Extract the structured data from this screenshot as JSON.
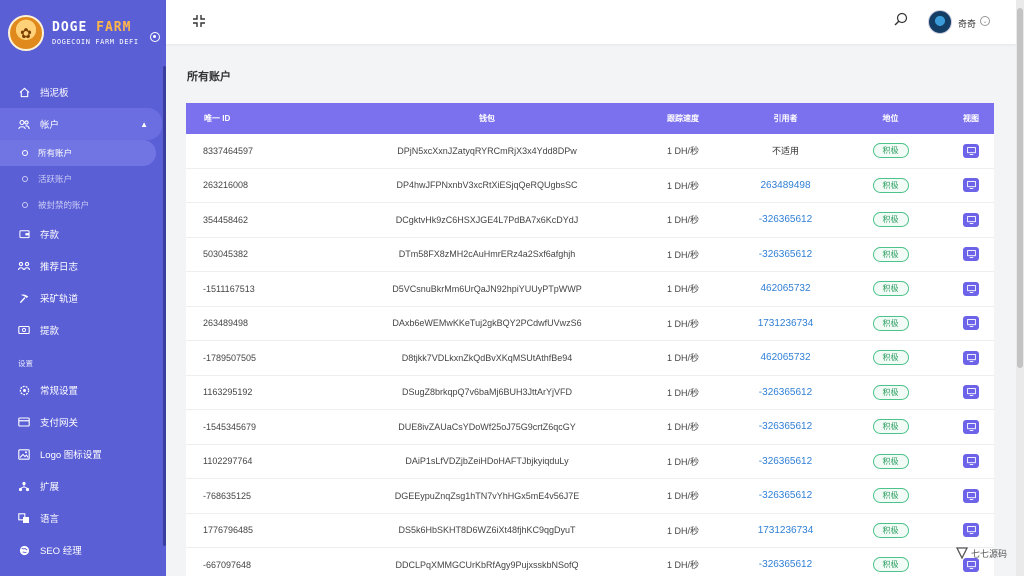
{
  "brand": {
    "title_main": "DOGE",
    "title_accent": "FARM",
    "subtitle": "DOGECOIN FARM DEFI"
  },
  "nav": {
    "dashboard": "挡泥板",
    "accounts": "帐户",
    "sub_all": "所有账户",
    "sub_active": "活跃账户",
    "sub_banned": "被封禁的账户",
    "deposit": "存款",
    "referral_log": "推荐日志",
    "mining_track": "采矿轨道",
    "withdraw": "提款",
    "section_settings": "设置",
    "general_settings": "常规设置",
    "payment_gateway": "支付网关",
    "logo_settings": "Logo 图标设置",
    "extensions": "扩展",
    "language": "语言",
    "seo": "SEO 经理"
  },
  "topbar": {
    "username": "奇奇"
  },
  "page": {
    "title": "所有账户"
  },
  "table": {
    "headers": [
      "唯一 ID",
      "钱包",
      "跟踪速度",
      "引用者",
      "地位",
      "视图"
    ],
    "rows": [
      {
        "id": "8337464597",
        "wallet": "DPjN5xcXxnJZatyqRYRCmRjX3x4Ydd8DPw",
        "speed": "1 DH/秒",
        "ref": "不适用",
        "status": "积极"
      },
      {
        "id": "263216008",
        "wallet": "DP4hwJFPNxnbV3xcRtXiESjqQeRQUgbsSC",
        "speed": "1 DH/秒",
        "ref": "263489498",
        "status": "积极"
      },
      {
        "id": "354458462",
        "wallet": "DCgktvHk9zC6HSXJGE4L7PdBA7x6KcDYdJ",
        "speed": "1 DH/秒",
        "ref": "-326365612",
        "status": "积极"
      },
      {
        "id": "503045382",
        "wallet": "DTm58FX8zMH2cAuHmrERz4a2Sxf6afghjh",
        "speed": "1 DH/秒",
        "ref": "-326365612",
        "status": "积极"
      },
      {
        "id": "-1511167513",
        "wallet": "D5VCsnuBkrMm6UrQaJN92hpiYUUyPTpWWP",
        "speed": "1 DH/秒",
        "ref": "462065732",
        "status": "积极"
      },
      {
        "id": "263489498",
        "wallet": "DAxb6eWEMwKKeTuj2gkBQY2PCdwfUVwzS6",
        "speed": "1 DH/秒",
        "ref": "1731236734",
        "status": "积极"
      },
      {
        "id": "-1789507505",
        "wallet": "D8tjkk7VDLkxnZkQdBvXKqMSUtAthfBe94",
        "speed": "1 DH/秒",
        "ref": "462065732",
        "status": "积极"
      },
      {
        "id": "1163295192",
        "wallet": "DSugZ8brkqpQ7v6baMj6BUH3JttArYjVFD",
        "speed": "1 DH/秒",
        "ref": "-326365612",
        "status": "积极"
      },
      {
        "id": "-1545345679",
        "wallet": "DUE8ivZAUaCsYDoWf25oJ75G9crtZ6qcGY",
        "speed": "1 DH/秒",
        "ref": "-326365612",
        "status": "积极"
      },
      {
        "id": "1102297764",
        "wallet": "DAiP1sLfVDZjbZeiHDoHAFTJbjkyiqduLy",
        "speed": "1 DH/秒",
        "ref": "-326365612",
        "status": "积极"
      },
      {
        "id": "-768635125",
        "wallet": "DGEEypuZnqZsg1hTN7vYhHGx5mE4v56J7E",
        "speed": "1 DH/秒",
        "ref": "-326365612",
        "status": "积极"
      },
      {
        "id": "1776796485",
        "wallet": "DS5k6HbSKHT8D6WZ6iXt48fjhKC9qgDyuT",
        "speed": "1 DH/秒",
        "ref": "1731236734",
        "status": "积极"
      },
      {
        "id": "-667097648",
        "wallet": "DDCLPqXMMGCUrKbRfAgy9PujxsskbNSofQ",
        "speed": "1 DH/秒",
        "ref": "-326365612",
        "status": "积极"
      }
    ]
  },
  "watermark": {
    "text": "七七源码"
  },
  "colors": {
    "sidebar": "#5b5fd6",
    "header": "#7b70ee",
    "link": "#2f7fd6",
    "badge": "#4cc38a",
    "view_button": "#6c63e8"
  }
}
